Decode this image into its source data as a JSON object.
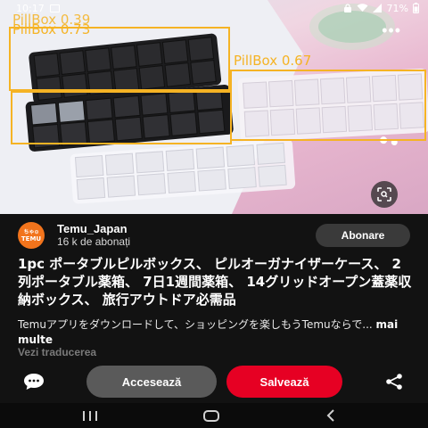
{
  "status_bar": {
    "time": "10:17",
    "battery": "71%",
    "icons": [
      "image-icon",
      "lock-icon",
      "wifi-icon",
      "signal-icon",
      "battery-icon"
    ]
  },
  "hero": {
    "detections": [
      {
        "label": "PillBox 0.39"
      },
      {
        "label": "PillBox 0.73"
      },
      {
        "label": "PillBox 0.67"
      }
    ],
    "box_color": "#f5b324",
    "more_label": "•••"
  },
  "profile": {
    "avatar_top": "ちゃ⊙",
    "avatar_bottom": "TEMU",
    "name": "Temu_Japan",
    "subscribers": "16 k de abonați",
    "subscribe_label": "Abonare"
  },
  "pin": {
    "title": "1pc ポータブルピルボックス、 ピルオーガナイザーケース、 2列ポータブル薬箱、 7日1週間薬箱、 14グリッドオープン蓋薬収納ボックス、 旅行アウトドア必需品",
    "description": "Temuアプリをダウンロードして、ショッピングを楽しもうTemuならで...",
    "more_label": "mai multe",
    "translate_label": "Vezi traducerea"
  },
  "actions": {
    "visit_label": "Accesează",
    "save_label": "Salvează",
    "save_color": "#e60023"
  }
}
